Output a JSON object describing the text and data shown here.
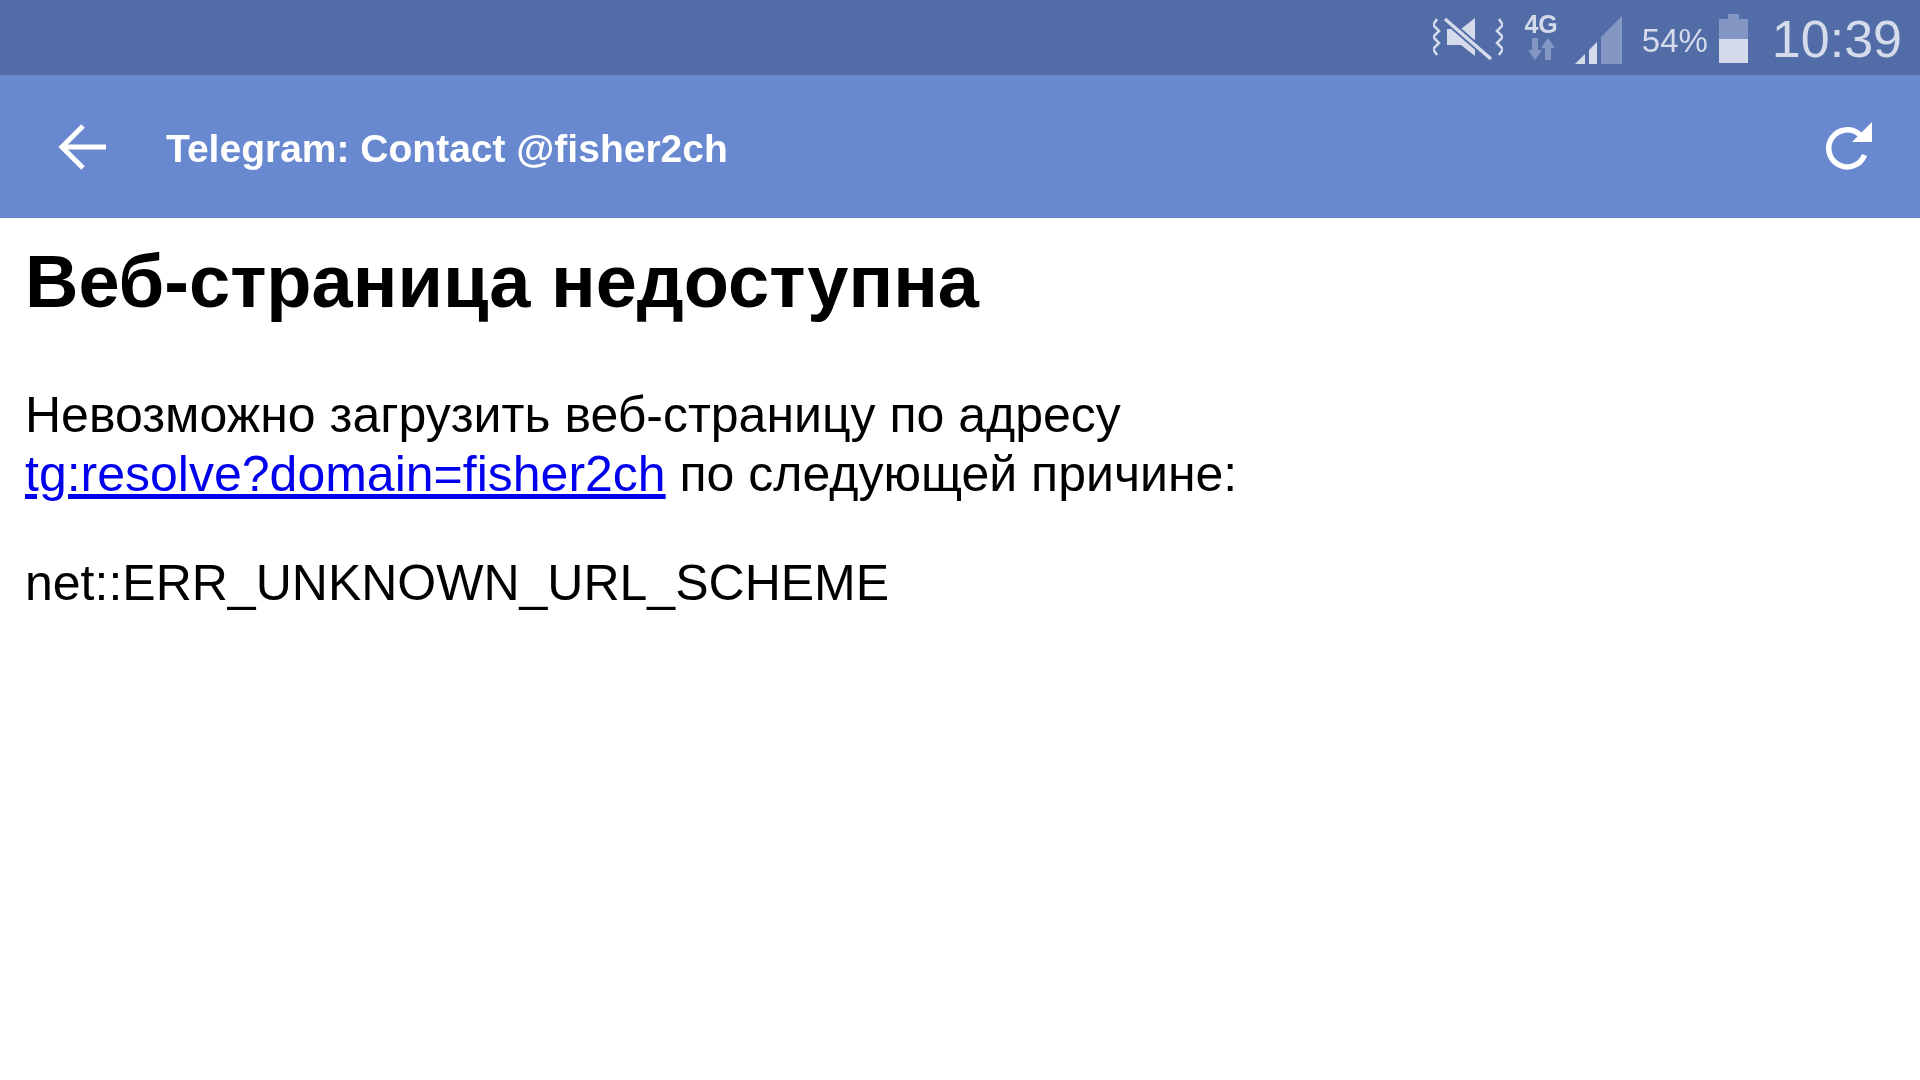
{
  "status_bar": {
    "network_type": "4G",
    "battery_percent": "54%",
    "time": "10:39"
  },
  "app_bar": {
    "title": "Telegram: Contact @fisher2ch"
  },
  "page": {
    "heading": "Веб-страница недоступна",
    "message": {
      "text_before": "Невозможно загрузить веб-страницу по адресу",
      "link": "tg:resolve?domain=fisher2ch",
      "text_after": "по следующей причине:"
    },
    "error_code": "net::ERR_UNKNOWN_URL_SCHEME"
  }
}
